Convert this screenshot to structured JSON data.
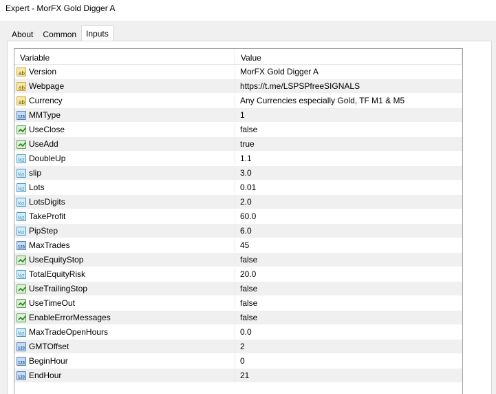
{
  "window": {
    "title": "Expert - MorFX Gold Digger A"
  },
  "tabs": [
    {
      "label": "About",
      "active": false
    },
    {
      "label": "Common",
      "active": false
    },
    {
      "label": "Inputs",
      "active": true
    }
  ],
  "grid": {
    "headers": {
      "variable": "Variable",
      "value": "Value"
    },
    "rows": [
      {
        "variable": "Version",
        "value": "MorFX Gold Digger A",
        "type": "string",
        "icon": "ab-string-icon"
      },
      {
        "variable": "Webpage",
        "value": "https://t.me/LSPSPfreeSIGNALS",
        "type": "string",
        "icon": "ab-string-icon"
      },
      {
        "variable": "Currency",
        "value": "Any Currencies especially Gold, TF M1 & M5",
        "type": "string",
        "icon": "ab-string-icon"
      },
      {
        "variable": "MMType",
        "value": "1",
        "type": "int",
        "icon": "integer-icon"
      },
      {
        "variable": "UseClose",
        "value": "false",
        "type": "bool",
        "icon": "boolean-icon"
      },
      {
        "variable": "UseAdd",
        "value": "true",
        "type": "bool",
        "icon": "boolean-icon"
      },
      {
        "variable": "DoubleUp",
        "value": "1.1",
        "type": "double",
        "icon": "double-icon"
      },
      {
        "variable": "slip",
        "value": "3.0",
        "type": "double",
        "icon": "double-icon"
      },
      {
        "variable": "Lots",
        "value": "0.01",
        "type": "double",
        "icon": "double-icon"
      },
      {
        "variable": "LotsDigits",
        "value": "2.0",
        "type": "double",
        "icon": "double-icon"
      },
      {
        "variable": "TakeProfit",
        "value": "60.0",
        "type": "double",
        "icon": "double-icon"
      },
      {
        "variable": "PipStep",
        "value": "6.0",
        "type": "double",
        "icon": "double-icon"
      },
      {
        "variable": "MaxTrades",
        "value": "45",
        "type": "int",
        "icon": "integer-icon"
      },
      {
        "variable": "UseEquityStop",
        "value": "false",
        "type": "bool",
        "icon": "boolean-icon"
      },
      {
        "variable": "TotalEquityRisk",
        "value": "20.0",
        "type": "double",
        "icon": "double-icon"
      },
      {
        "variable": "UseTrailingStop",
        "value": "false",
        "type": "bool",
        "icon": "boolean-icon"
      },
      {
        "variable": "UseTimeOut",
        "value": "false",
        "type": "bool",
        "icon": "boolean-icon"
      },
      {
        "variable": "EnableErrorMessages",
        "value": "false",
        "type": "bool",
        "icon": "boolean-icon"
      },
      {
        "variable": "MaxTradeOpenHours",
        "value": "0.0",
        "type": "double",
        "icon": "double-icon"
      },
      {
        "variable": "GMTOffset",
        "value": "2",
        "type": "int",
        "icon": "integer-icon"
      },
      {
        "variable": "BeginHour",
        "value": "0",
        "type": "int",
        "icon": "integer-icon"
      },
      {
        "variable": "EndHour",
        "value": "21",
        "type": "int",
        "icon": "integer-icon"
      }
    ]
  }
}
